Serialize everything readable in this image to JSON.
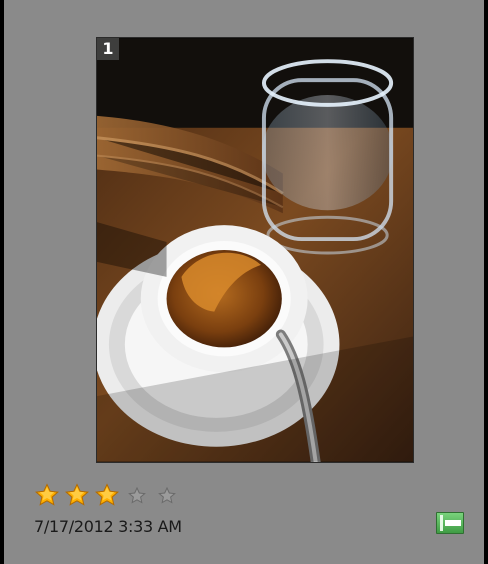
{
  "thumbnail": {
    "index_label": "1",
    "date_label": "7/17/2012 3:33 AM",
    "rating": {
      "value": 3,
      "max": 5
    },
    "icons": {
      "star_filled": "star-filled-icon",
      "star_empty": "star-empty-icon",
      "stack_button": "stack-icon"
    },
    "colors": {
      "background": "#8a8a8a",
      "photo_border": "#2b2b2b",
      "star_fill": "#ffb000",
      "stack_green": "#4caf50"
    }
  }
}
